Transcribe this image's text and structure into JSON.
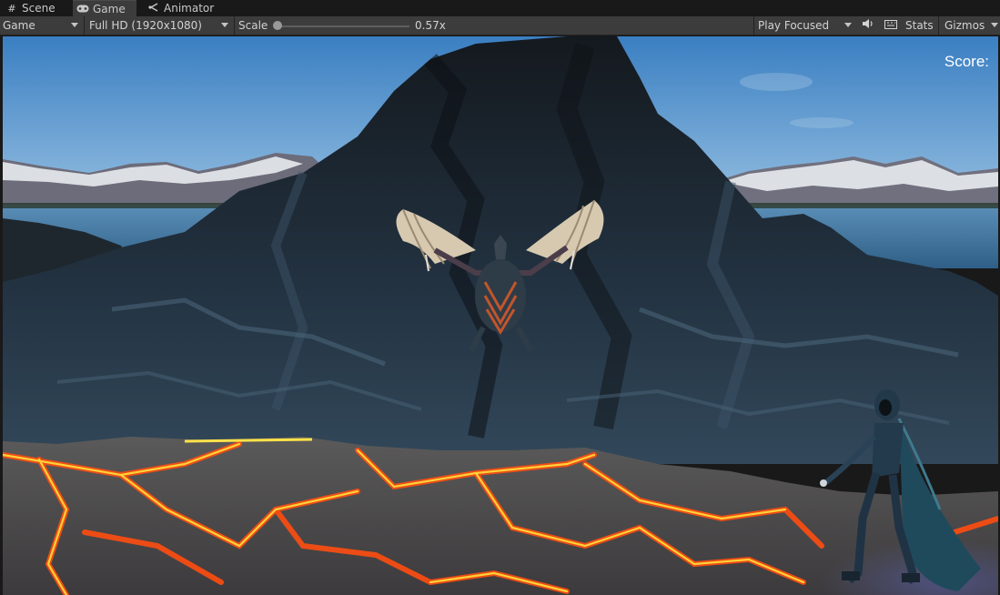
{
  "tabs": [
    {
      "label": "Scene",
      "icon": "grid-icon"
    },
    {
      "label": "Game",
      "icon": "gamepad-icon"
    },
    {
      "label": "Animator",
      "icon": "animator-icon"
    }
  ],
  "toolbar": {
    "display": "Game",
    "resolution": "Full HD (1920x1080)",
    "scale_label": "Scale",
    "scale_value": "0.57x",
    "play_mode": "Play Focused",
    "stats_label": "Stats",
    "gizmos_label": "Gizmos"
  },
  "game": {
    "score_label": "Score:"
  },
  "colors": {
    "editor_bg": "#191919",
    "toolbar_bg": "#3c3c3c",
    "sky_top": "#3d82c4",
    "sky_bottom": "#9cc6e6",
    "rock": "#1f2a33",
    "lava": "#ff5a12",
    "lava_glow": "#ffd23a"
  }
}
